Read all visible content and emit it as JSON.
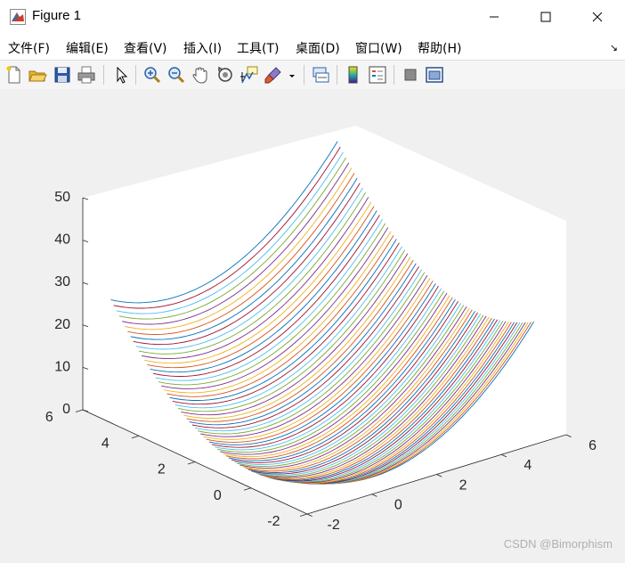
{
  "window": {
    "title": "Figure 1",
    "controls": {
      "minimize": "minimize-icon",
      "maximize": "maximize-icon",
      "close": "close-icon"
    }
  },
  "menu": {
    "items": [
      "文件(F)",
      "编辑(E)",
      "查看(V)",
      "插入(I)",
      "工具(T)",
      "桌面(D)",
      "窗口(W)",
      "帮助(H)"
    ]
  },
  "toolbar": {
    "buttons": [
      "new-figure-icon",
      "open-file-icon",
      "save-icon",
      "print-icon",
      "edit-plot-arrow-icon",
      "zoom-in-icon",
      "zoom-out-icon",
      "pan-hand-icon",
      "rotate-3d-icon",
      "data-cursor-icon",
      "brush-icon",
      "brush-dropdown-icon",
      "link-plot-icon",
      "colorbar-icon",
      "legend-icon",
      "hide-plot-tools-icon",
      "show-plot-tools-icon"
    ]
  },
  "chart_data": {
    "type": "line",
    "title": "",
    "xlabel": "",
    "ylabel": "",
    "zlabel": "",
    "xlim": [
      -2,
      6
    ],
    "ylim": [
      -2,
      6
    ],
    "zlim": [
      0,
      50
    ],
    "xticks": [
      "-2",
      "0",
      "2",
      "4",
      "6"
    ],
    "yticks": [
      "-2",
      "0",
      "2",
      "4",
      "6"
    ],
    "zticks": [
      "0",
      "10",
      "20",
      "30",
      "40",
      "50"
    ],
    "series_description_values": {
      "x_range": [
        -2,
        5
      ],
      "y_range": [
        -2,
        5
      ],
      "line_count": 71,
      "z_min": 0,
      "z_max": 49
    },
    "colors": [
      "#0072BD",
      "#D95319",
      "#EDB120",
      "#7E2F8E",
      "#77AC30",
      "#4DBEEE",
      "#A2142F"
    ],
    "grid": false,
    "legend": "none"
  },
  "watermark": "CSDN @Bimorphism"
}
